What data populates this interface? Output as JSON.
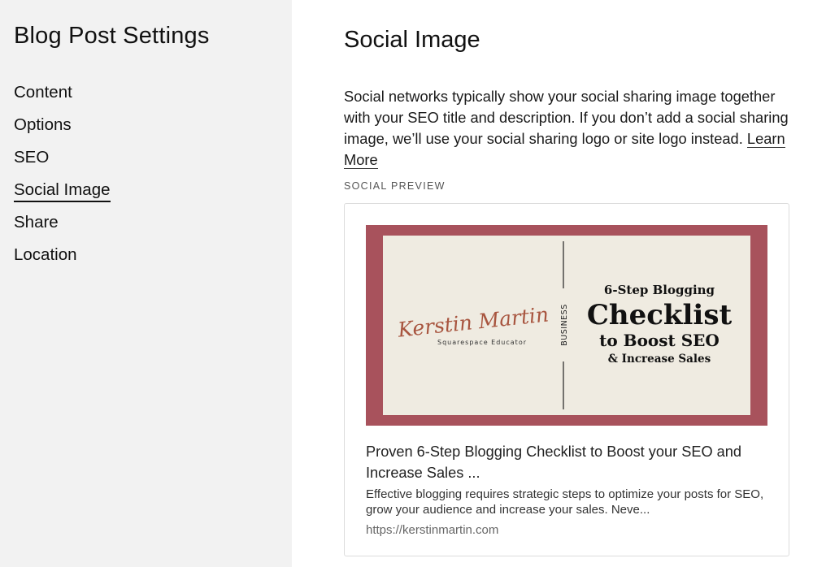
{
  "sidebar": {
    "title": "Blog Post Settings",
    "items": [
      {
        "label": "Content",
        "active": false
      },
      {
        "label": "Options",
        "active": false
      },
      {
        "label": "SEO",
        "active": false
      },
      {
        "label": "Social Image",
        "active": true
      },
      {
        "label": "Share",
        "active": false
      },
      {
        "label": "Location",
        "active": false
      }
    ]
  },
  "main": {
    "title": "Social Image",
    "description": "Social networks typically show your social sharing image together with your SEO title and description. If you don’t add a social sharing image, we’ll use your social sharing logo or site logo instead.",
    "learn_more": "Learn More",
    "section_label": "SOCIAL PREVIEW"
  },
  "preview": {
    "image": {
      "logo_script": "Kerstin Martin",
      "logo_sub": "Squarespace Educator",
      "category": "BUSINESS",
      "line1": "6-Step Blogging",
      "line2": "Checklist",
      "line3": "to Boost SEO",
      "line4": "& Increase Sales",
      "frame_color": "#a8525c",
      "inner_color": "#efebe1"
    },
    "title": "Proven 6-Step Blogging Checklist to Boost your SEO and Increase Sales ...",
    "description": "Effective blogging requires strategic steps to optimize your posts for SEO, grow your audience and increase your sales. Neve...",
    "url": "https://kerstinmartin.com"
  }
}
